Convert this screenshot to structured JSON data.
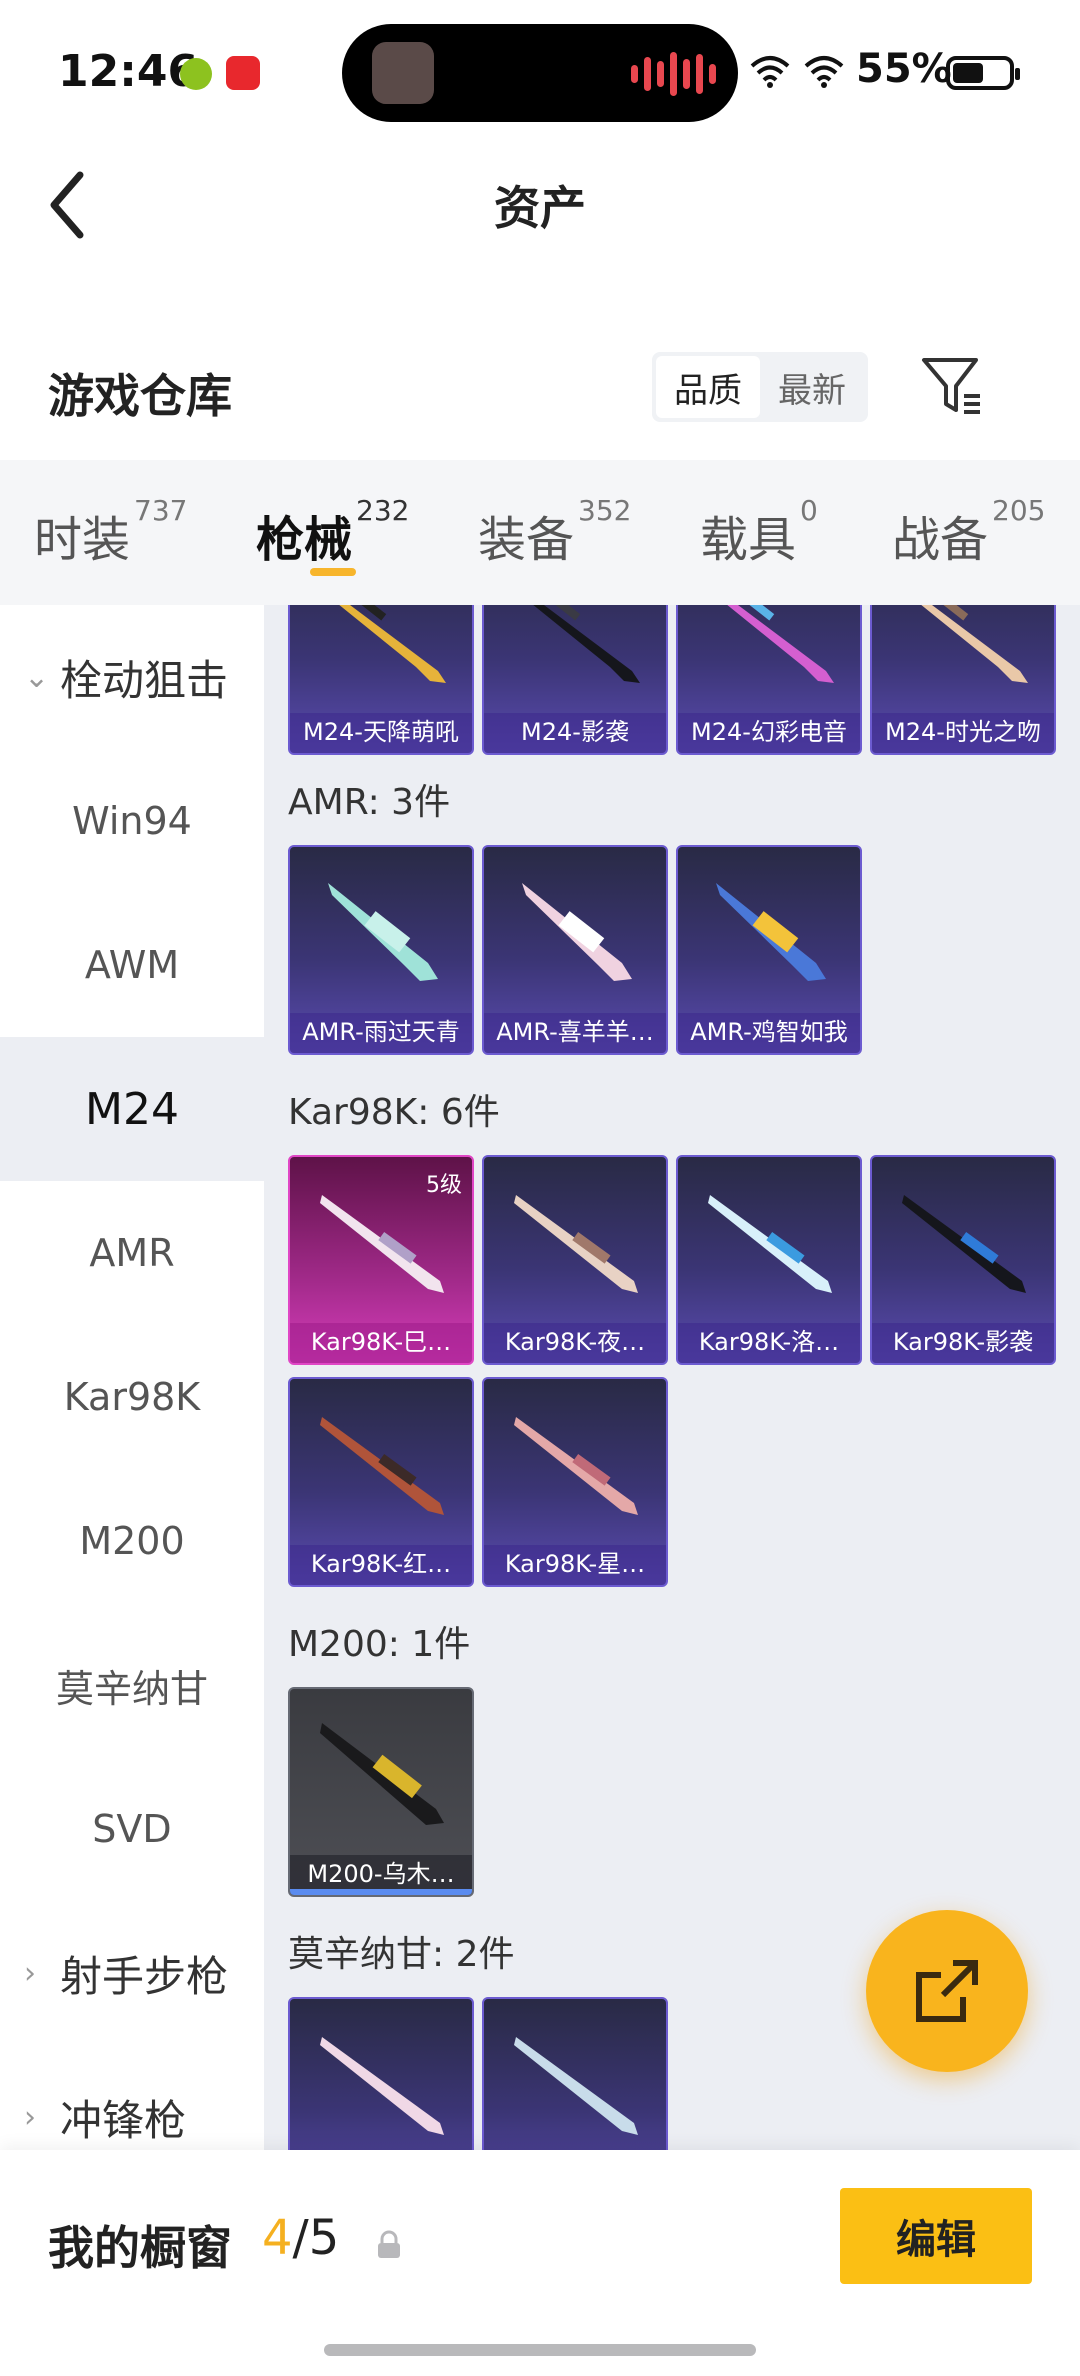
{
  "status": {
    "time": "12:46",
    "battery": "55%",
    "battery_level": 0.55
  },
  "nav": {
    "title": "资产",
    "back_icon": "chevron-left-icon"
  },
  "header": {
    "title": "游戏仓库",
    "sort_options": [
      "品质",
      "最新"
    ],
    "sort_selected": "品质",
    "filter_icon": "filter-icon"
  },
  "tabs": [
    {
      "label": "时装",
      "count": "737"
    },
    {
      "label": "枪械",
      "count": "232"
    },
    {
      "label": "装备",
      "count": "352"
    },
    {
      "label": "载具",
      "count": "0"
    },
    {
      "label": "战备",
      "count": "205"
    }
  ],
  "active_tab": "枪械",
  "sidebar": {
    "group_open": "栓动狙击",
    "items": [
      "Win94",
      "AWM",
      "M24",
      "AMR",
      "Kar98K",
      "M200",
      "莫辛纳甘",
      "SVD"
    ],
    "selected": "M24",
    "groups_collapsed": [
      "射手步枪",
      "冲锋枪"
    ]
  },
  "sections": {
    "m24_items": [
      "M24-天降萌吼",
      "M24-影袭",
      "M24-幻彩电音",
      "M24-时光之吻"
    ],
    "amr_title": "AMR: 3件",
    "amr_items": [
      "AMR-雨过天青",
      "AMR-喜羊羊…",
      "AMR-鸡智如我"
    ],
    "kar_title": "Kar98K: 6件",
    "kar_items": [
      "Kar98K-巳…",
      "Kar98K-夜…",
      "Kar98K-洛…",
      "Kar98K-影袭",
      "Kar98K-红…",
      "Kar98K-星…"
    ],
    "kar_level": "5级",
    "m200_title": "M200: 1件",
    "m200_items": [
      "M200-乌木…"
    ],
    "mosin_title": "莫辛纳甘: 2件"
  },
  "bottom": {
    "label": "我的橱窗",
    "current": "4",
    "slash_total": "/5",
    "edit": "编辑"
  },
  "colors": {
    "accent": "#fbbf14",
    "card_purple": "#3b3575",
    "card_epic": "#a22a8a"
  }
}
